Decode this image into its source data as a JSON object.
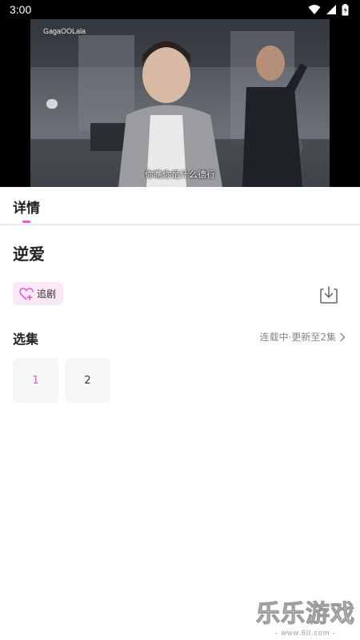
{
  "status_bar": {
    "time": "3:00"
  },
  "video": {
    "watermark": "GagaOOLala",
    "subtitle": "你瞧你是什么德行"
  },
  "tabs": [
    {
      "label": "详情",
      "active": true
    }
  ],
  "drama": {
    "title": "逆爱"
  },
  "actions": {
    "follow_label": "追剧",
    "download_icon": "download-icon"
  },
  "episodes": {
    "label": "选集",
    "status": "连载中·更新至2集",
    "items": [
      {
        "label": "1",
        "active": true
      },
      {
        "label": "2",
        "active": false
      }
    ]
  },
  "watermark": {
    "main": "乐乐游戏",
    "sub": "- www.6ll.com -"
  },
  "colors": {
    "accent": "#e05ad8",
    "follow_bg": "#fbe8f7",
    "episode_bg": "#f5f6f8"
  }
}
